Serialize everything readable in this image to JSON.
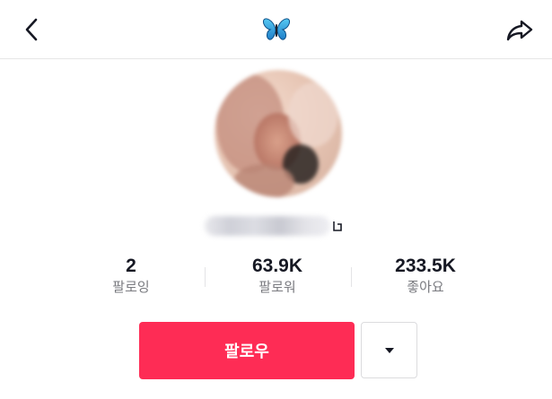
{
  "header": {
    "back_icon": "chevron-left-icon",
    "logo_icon": "butterfly-logo-icon",
    "share_icon": "share-arrow-icon"
  },
  "profile": {
    "avatar": "blurred-profile-photo",
    "username_blurred": true
  },
  "stats": [
    {
      "value": "2",
      "label": "팔로잉"
    },
    {
      "value": "63.9K",
      "label": "팔로워"
    },
    {
      "value": "233.5K",
      "label": "좋아요"
    }
  ],
  "actions": {
    "follow_label": "팔로우",
    "more_icon": "caret-down-icon"
  },
  "colors": {
    "accent": "#fe2c55",
    "text_primary": "#161823",
    "text_secondary": "#7a7b80",
    "logo": "#2fa8e6"
  }
}
